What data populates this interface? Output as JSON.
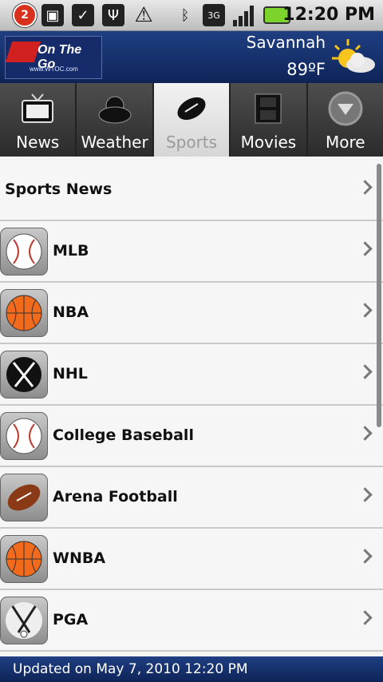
{
  "status_bar": {
    "notification_count": "2",
    "time": "12:20 PM",
    "icons": [
      "notification-icon",
      "clipboard-icon",
      "download-done-icon",
      "usb-icon",
      "warning-icon",
      "bluetooth-icon",
      "3g-icon",
      "signal-icon",
      "battery-icon"
    ]
  },
  "header": {
    "logo_text": "On The Go",
    "logo_sub": "www.WTOC.com",
    "city": "Savannah",
    "temperature": "89ºF",
    "weather_icon": "partly-sunny-icon"
  },
  "tabs": [
    {
      "label": "News",
      "icon": "tv-icon",
      "active": false
    },
    {
      "label": "Weather",
      "icon": "cloud-sun-icon",
      "active": false
    },
    {
      "label": "Sports",
      "icon": "football-icon",
      "active": true
    },
    {
      "label": "Movies",
      "icon": "film-icon",
      "active": false
    },
    {
      "label": "More",
      "icon": "chevron-down-icon",
      "active": false
    }
  ],
  "list": {
    "header_item": "Sports News",
    "items": [
      {
        "label": "MLB",
        "icon": "baseball-icon"
      },
      {
        "label": "NBA",
        "icon": "basketball-icon"
      },
      {
        "label": "NHL",
        "icon": "hockey-icon"
      },
      {
        "label": "College Baseball",
        "icon": "baseball-icon"
      },
      {
        "label": "Arena Football",
        "icon": "football-icon"
      },
      {
        "label": "WNBA",
        "icon": "basketball-icon"
      },
      {
        "label": "PGA",
        "icon": "golf-icon"
      }
    ]
  },
  "footer": {
    "updated_text": "Updated on May 7, 2010 12:20 PM"
  },
  "colors": {
    "header_blue": "#1f3f82",
    "accent_red": "#d02020",
    "basketball_orange": "#f26a1b",
    "football_brown": "#8a3a17"
  }
}
